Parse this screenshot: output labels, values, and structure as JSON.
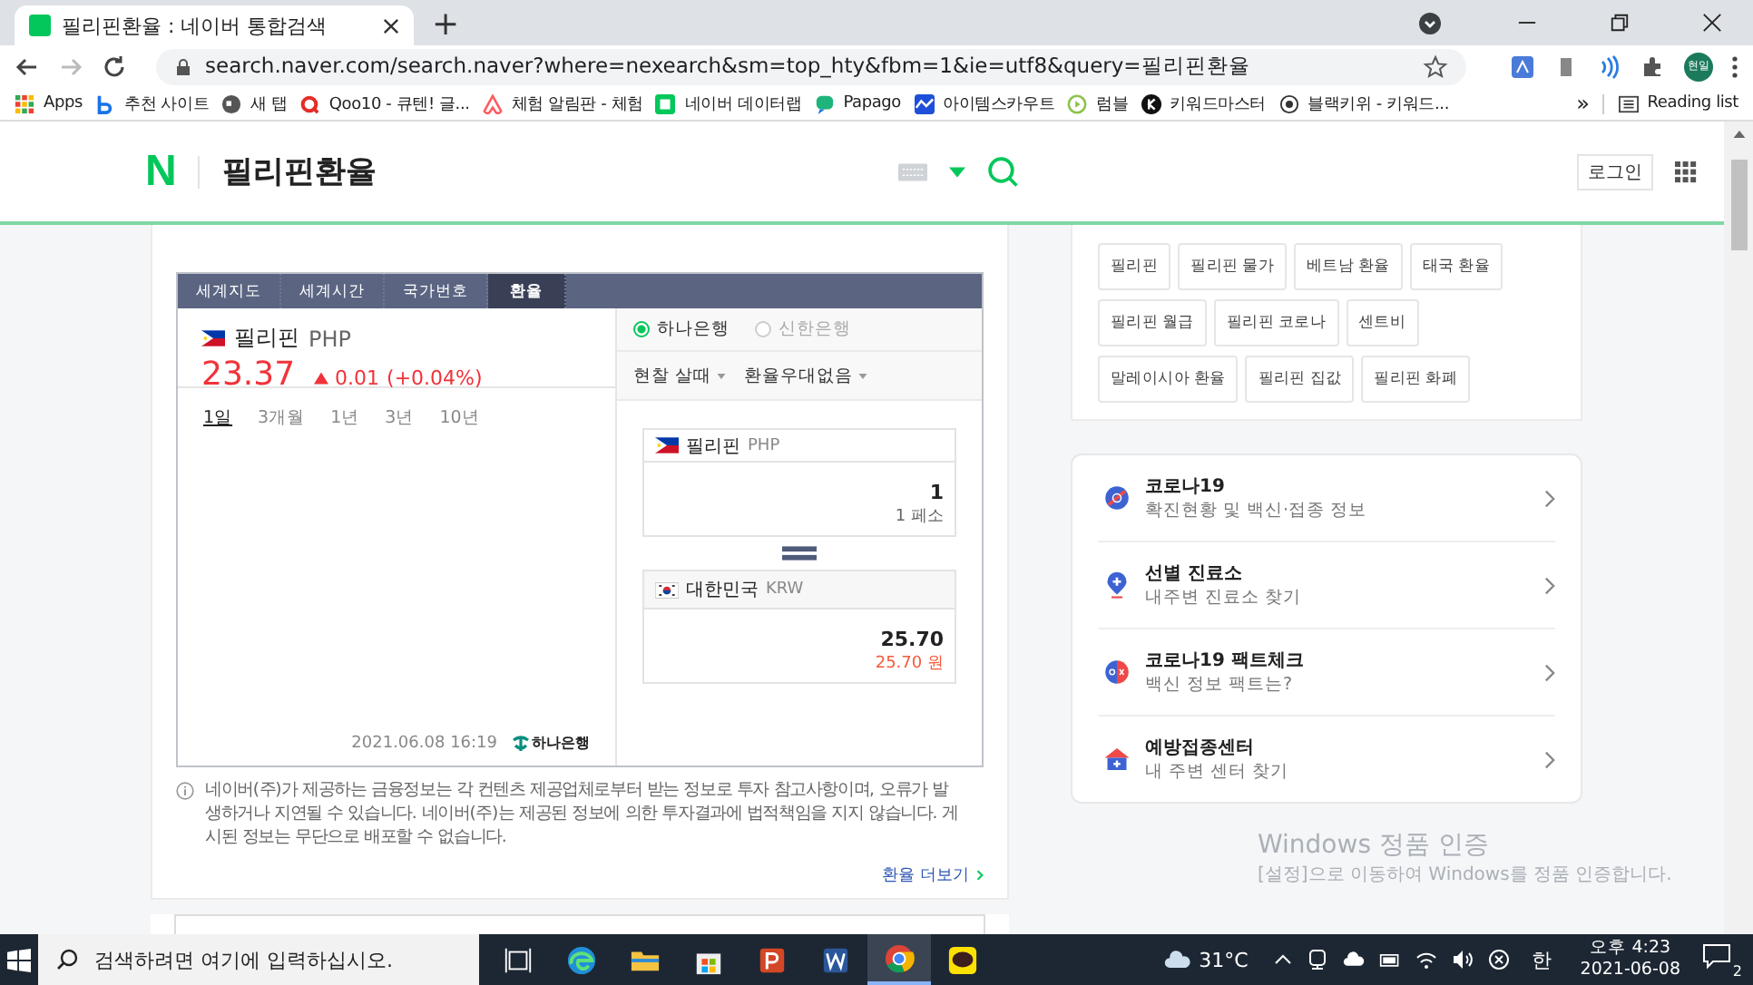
{
  "browser": {
    "tab_title": "필리핀환율 : 네이버 통합검색",
    "new_tab": "+",
    "url": "search.naver.com/search.naver?where=nexearch&sm=top_hty&fbm=1&ie=utf8&query=필리핀환율",
    "profile": "현일",
    "bookmarks": [
      {
        "kind": "apps",
        "label": "Apps"
      },
      {
        "kind": "b",
        "label": "추천 사이트"
      },
      {
        "kind": "globe",
        "label": "새 탭"
      },
      {
        "kind": "q",
        "label": "Qoo10 - 큐텐! 글..."
      },
      {
        "kind": "airbnb",
        "label": "체험 알림판 - 체험"
      },
      {
        "kind": "datalab",
        "label": "네이버 데이터랩"
      },
      {
        "kind": "papago",
        "label": "Papago"
      },
      {
        "kind": "wave",
        "label": "아이템스카우트"
      },
      {
        "kind": "play",
        "label": "럼블"
      },
      {
        "kind": "k",
        "label": "키워드마스터"
      },
      {
        "kind": "dot",
        "label": "블랙키위 - 키워드..."
      }
    ],
    "more": "»",
    "reading_list": "Reading list"
  },
  "header": {
    "logo": "N",
    "query": "필리핀환율",
    "login": "로그인"
  },
  "widget": {
    "tabs": [
      {
        "label": "세계지도",
        "selected": false
      },
      {
        "label": "세계시간",
        "selected": false
      },
      {
        "label": "국가번호",
        "selected": false
      },
      {
        "label": "환율",
        "selected": true
      }
    ],
    "currency": {
      "name": "필리핀",
      "code": "PHP",
      "rate": "23.37",
      "rising": true,
      "change": "0.01",
      "change_pct": "(+0.04%)"
    },
    "banks": [
      {
        "label": "하나은행",
        "selected": true
      },
      {
        "label": "신한은행",
        "selected": false
      }
    ],
    "dropdowns": [
      "현찰 살때",
      "환율우대없음"
    ],
    "periods": [
      {
        "label": "1일",
        "selected": true
      },
      {
        "label": "3개월",
        "selected": false
      },
      {
        "label": "1년",
        "selected": false
      },
      {
        "label": "3년",
        "selected": false
      },
      {
        "label": "10년",
        "selected": false
      }
    ],
    "from": {
      "kind": "ph",
      "name": "필리핀",
      "code": "PHP",
      "amount": "1",
      "unit": "1 페소"
    },
    "to": {
      "kind": "kr",
      "name": "대한민국",
      "code": "KRW",
      "amount": "25.70",
      "unit": "25.70 원"
    },
    "timestamp": "2021.06.08 16:19",
    "source": "하나은행"
  },
  "notice": "네이버(주)가 제공하는 금융정보는 각 컨텐츠 제공업체로부터 받는 정보로 투자 참고사항이며, 오류가 발생하거나 지연될 수 있습니다. 네이버(주)는 제공된 정보에 의한 투자결과에 법적책임을 지지 않습니다. 게시된 정보는 무단으로 배포할 수 없습니다.",
  "more_link": "환율 더보기",
  "related": {
    "tags": [
      "필리핀",
      "필리핀 물가",
      "베트남 환율",
      "태국 환율",
      "필리핀 월급",
      "필리핀 코로나",
      "센트비",
      "말레이시아 환율",
      "필리핀 집값",
      "필리핀 화폐"
    ]
  },
  "covid": [
    {
      "kind": "virus",
      "title": "코로나19",
      "subtitle": "확진현황 및 백신·접종 정보"
    },
    {
      "kind": "pin",
      "title": "선별 진료소",
      "subtitle": "내주변 진료소 찾기"
    },
    {
      "kind": "ox",
      "title": "코로나19 팩트체크",
      "subtitle": "백신 정보 팩트는?"
    },
    {
      "kind": "house",
      "title": "예방접종센터",
      "subtitle": "내 주변 센터 찾기"
    }
  ],
  "activation": {
    "title": "Windows 정품 인증",
    "text": "[설정]으로 이동하여 Windows를 정품 인증합니다."
  },
  "taskbar": {
    "search_placeholder": "검색하려면 여기에 입력하십시오.",
    "apps": [
      {
        "kind": "taskview",
        "selected": false
      },
      {
        "kind": "edge",
        "selected": false
      },
      {
        "kind": "folder",
        "selected": false
      },
      {
        "kind": "store",
        "selected": false
      },
      {
        "kind": "ppt",
        "selected": false
      },
      {
        "kind": "word",
        "selected": false
      },
      {
        "kind": "chrome",
        "selected": true
      },
      {
        "kind": "talk",
        "selected": false
      }
    ],
    "weather": "31°C",
    "ime": "한",
    "time": "오후 4:23",
    "date": "2021-06-08",
    "notifications": "2"
  }
}
